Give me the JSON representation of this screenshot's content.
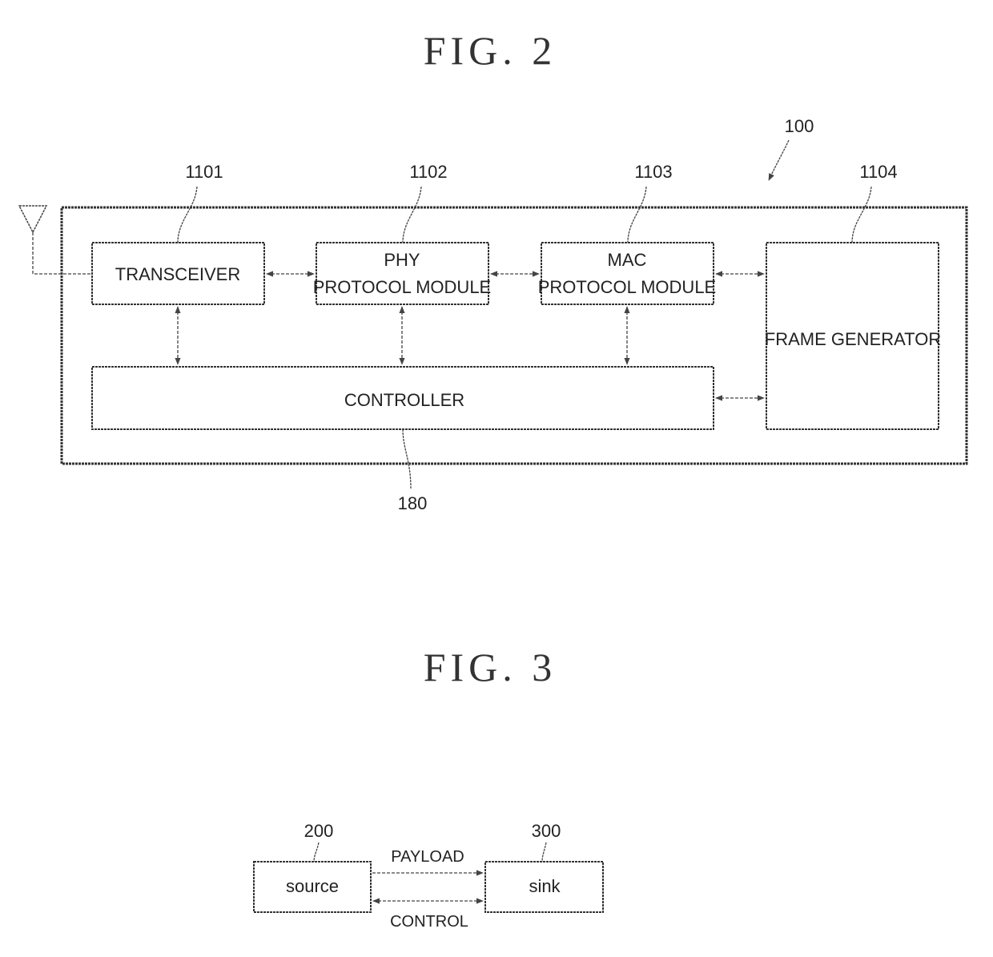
{
  "fig2": {
    "title": "FIG. 2",
    "device_ref": "100",
    "blocks": {
      "transceiver": {
        "label": "TRANSCEIVER",
        "ref": "1101"
      },
      "phy": {
        "label_line1": "PHY",
        "label_line2": "PROTOCOL MODULE",
        "ref": "1102"
      },
      "mac": {
        "label_line1": "MAC",
        "label_line2": "PROTOCOL MODULE",
        "ref": "1103"
      },
      "frame_generator": {
        "label": "FRAME GENERATOR",
        "ref": "1104"
      },
      "controller": {
        "label": "CONTROLLER",
        "ref": "180"
      }
    }
  },
  "fig3": {
    "title": "FIG. 3",
    "blocks": {
      "source": {
        "label": "source",
        "ref": "200"
      },
      "sink": {
        "label": "sink",
        "ref": "300"
      }
    },
    "links": {
      "payload": "PAYLOAD",
      "control": "CONTROL"
    }
  }
}
